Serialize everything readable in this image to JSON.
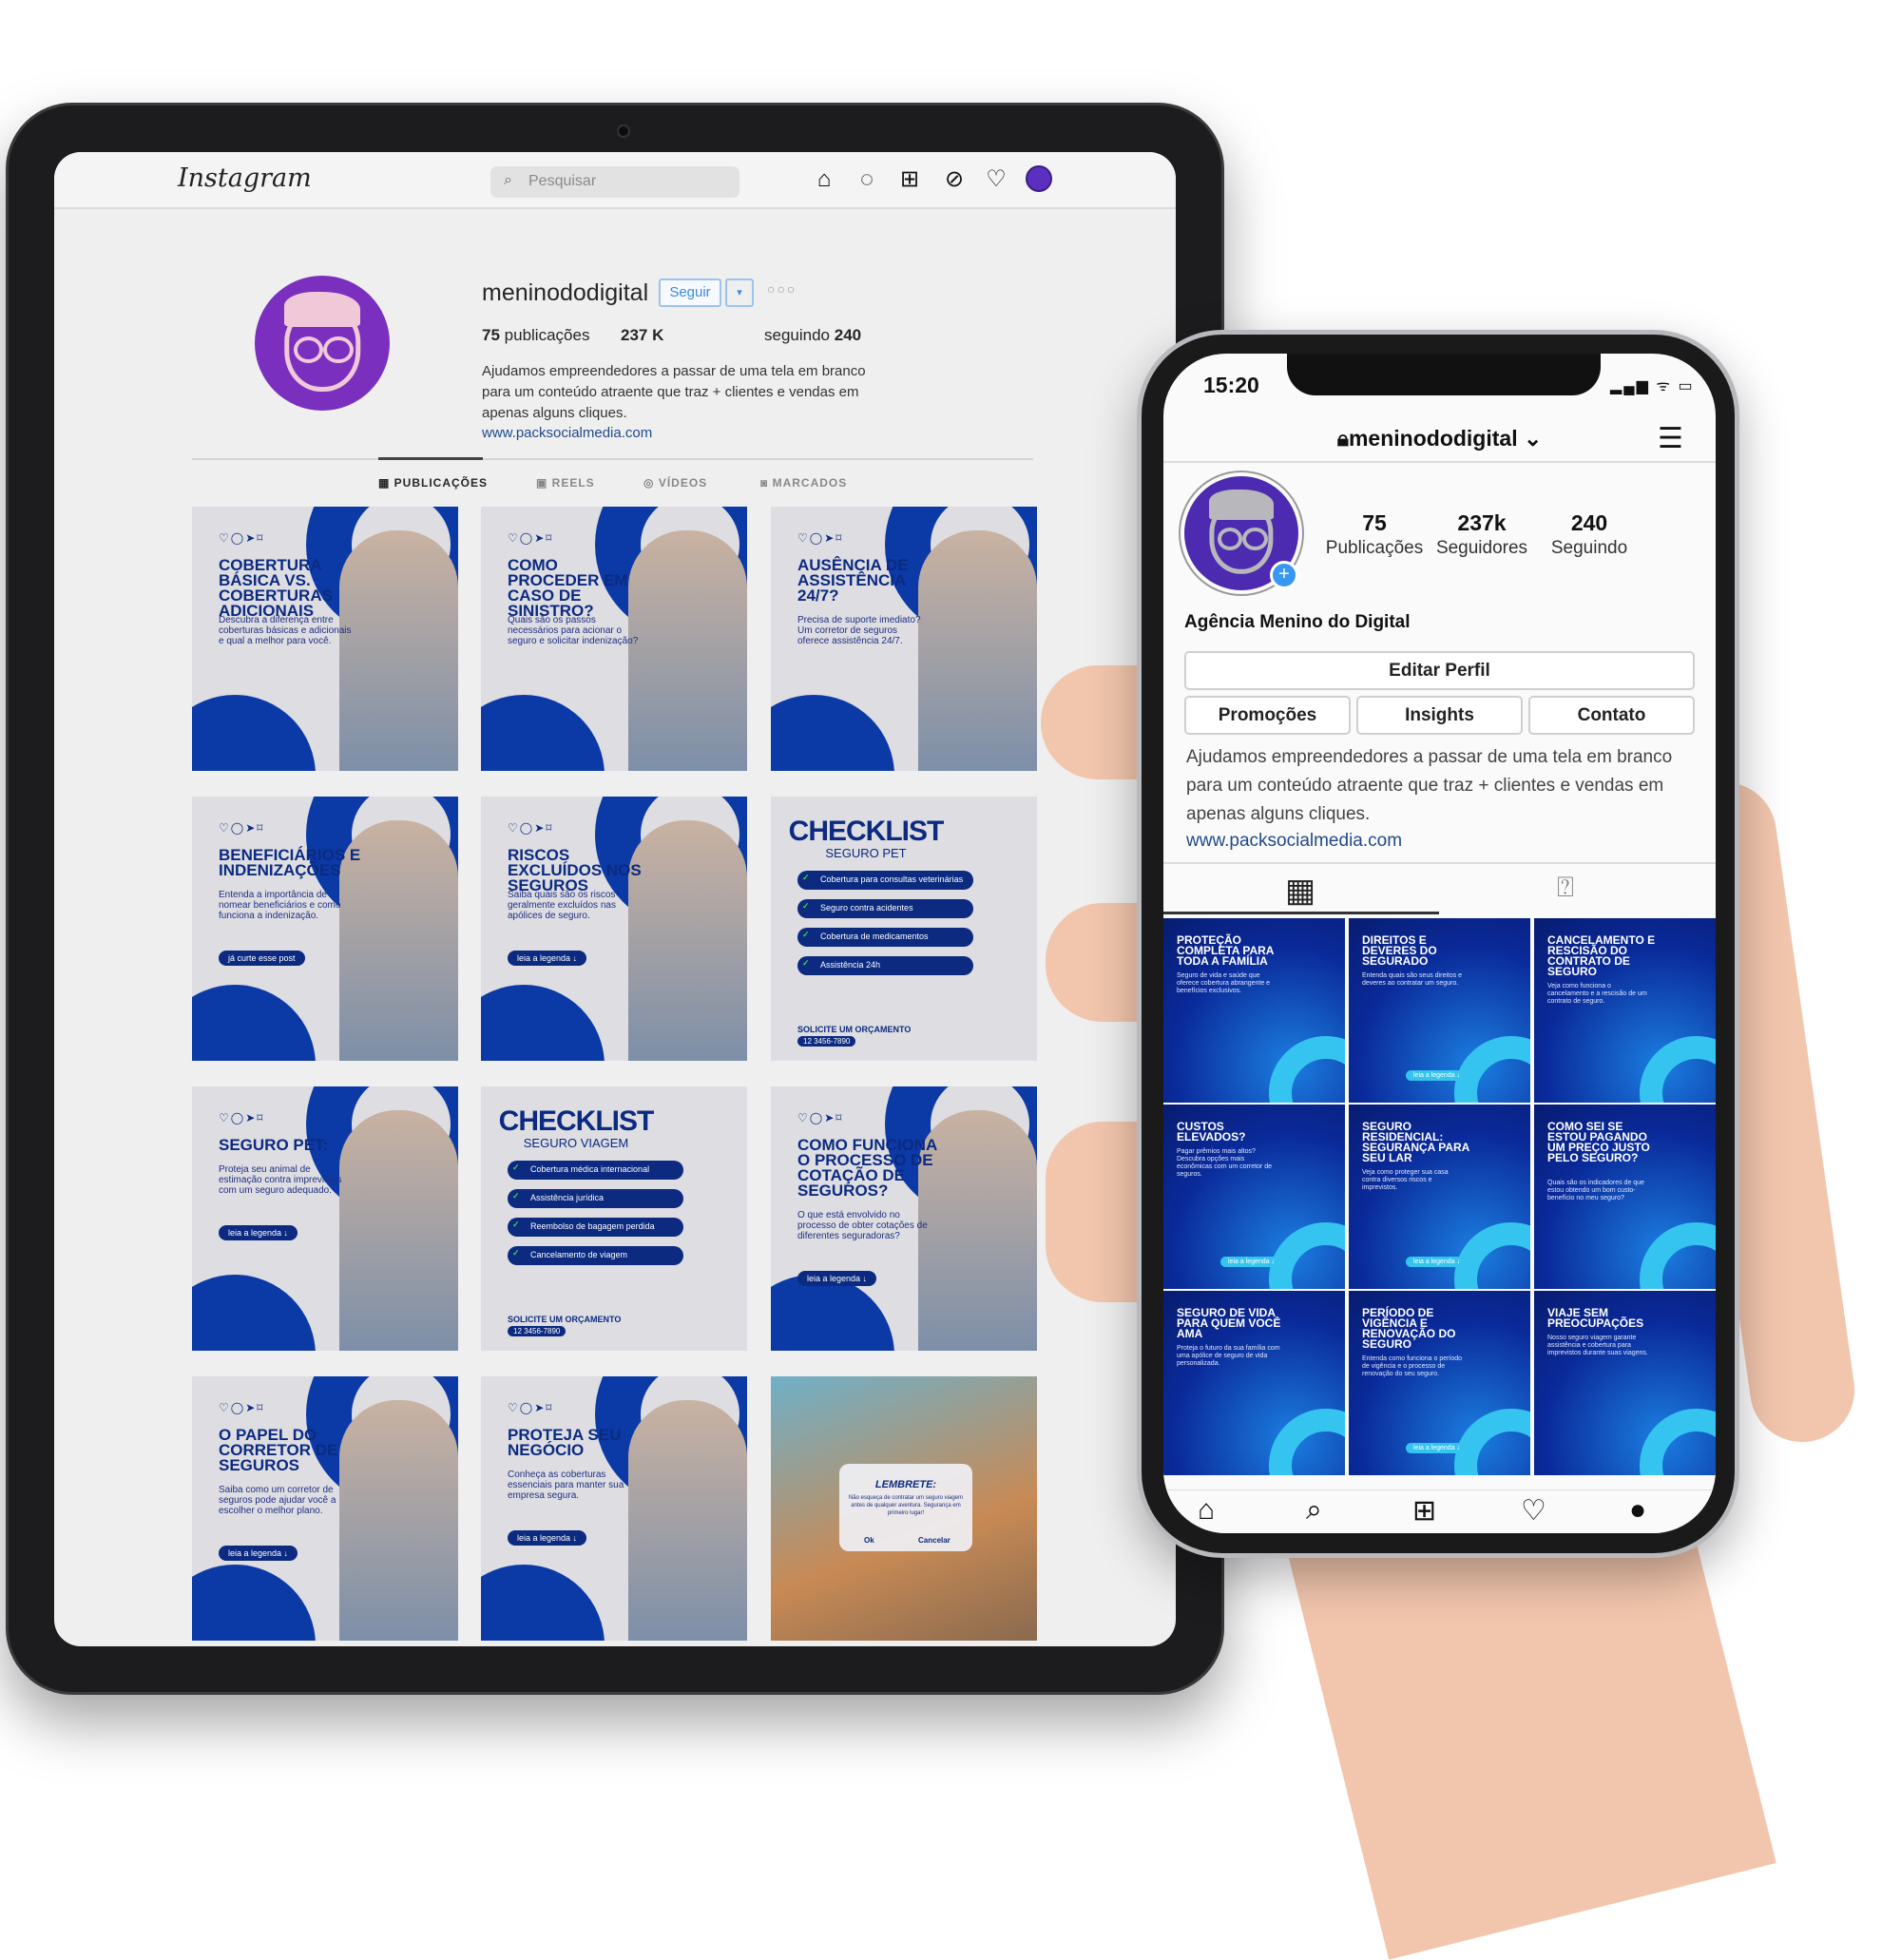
{
  "tablet": {
    "header": {
      "logo": "Instagram",
      "search_placeholder": "Pesquisar",
      "nav_icons": [
        "home-icon",
        "messenger-icon",
        "new-post-icon",
        "explore-icon",
        "heart-icon",
        "avatar-icon"
      ]
    },
    "profile": {
      "username": "meninododigital",
      "follow_label": "Seguir",
      "dropdown_label": "▾",
      "more_label": "○○○",
      "posts_count": "75",
      "posts_label": "publicações",
      "followers": "237 K",
      "following_label": "seguindo",
      "following_count": "240",
      "bio": "Ajudamos empreendedores a passar de uma tela em branco para um conteúdo atraente que traz + clientes e vendas em apenas alguns cliques.",
      "link": "www.packsocialmedia.com"
    },
    "tabs": [
      {
        "label": "PUBLICAÇÕES",
        "icon": "grid-icon",
        "active": true
      },
      {
        "label": "REELS",
        "icon": "reels-icon"
      },
      {
        "label": "VÍDEOS",
        "icon": "play-icon"
      },
      {
        "label": "MARCADOS",
        "icon": "tag-icon"
      }
    ],
    "posts": [
      {
        "type": "std",
        "title": "Cobertura básica vs. coberturas adicionais",
        "body": "Descubra a diferença entre coberturas básicas e adicionais e qual a melhor para você."
      },
      {
        "type": "std",
        "title": "Como proceder em caso de sinistro?",
        "body": "Quais são os passos necessários para acionar o seguro e solicitar indenização?"
      },
      {
        "type": "std",
        "title": "Ausência de assistência 24/7?",
        "body": "Precisa de suporte imediato? Um corretor de seguros oferece assistência 24/7."
      },
      {
        "type": "std",
        "title": "Beneficiários e indenizações",
        "body": "Entenda a importância de nomear beneficiários e como funciona a indenização.",
        "button": "já curte esse post"
      },
      {
        "type": "std",
        "title": "Riscos excluídos nos seguros",
        "body": "Saiba quais são os riscos geralmente excluídos nas apólices de seguro.",
        "button": "leia a legenda ↓"
      },
      {
        "type": "checklist",
        "title": "CHECKLIST",
        "subtitle": "SEGURO PET",
        "items": [
          "Cobertura para consultas veterinárias",
          "Seguro contra acidentes",
          "Cobertura de medicamentos",
          "Assistência 24h"
        ],
        "cta": "SOLICITE UM ORÇAMENTO",
        "phone": "12 3456-7890"
      },
      {
        "type": "std",
        "title": "Seguro pet:",
        "body": "Proteja seu animal de estimação contra imprevistos com um seguro adequado.",
        "button": "leia a legenda ↓"
      },
      {
        "type": "checklist",
        "title": "CHECKLIST",
        "subtitle": "SEGURO VIAGEM",
        "items": [
          "Cobertura médica internacional",
          "Assistência jurídica",
          "Reembolso de bagagem perdida",
          "Cancelamento de viagem"
        ],
        "cta": "SOLICITE UM ORÇAMENTO",
        "phone": "12 3456-7890"
      },
      {
        "type": "std",
        "title": "Como funciona o processo de cotação de seguros?",
        "body": "O que está envolvido no processo de obter cotações de diferentes seguradoras?",
        "button": "leia a legenda ↓"
      },
      {
        "type": "std",
        "title": "O papel do corretor de seguros",
        "body": "Saiba como um corretor de seguros pode ajudar você a escolher o melhor plano.",
        "button": "leia a legenda ↓"
      },
      {
        "type": "std",
        "title": "Proteja seu negócio",
        "body": "Conheça as coberturas essenciais para manter sua empresa segura.",
        "button": "leia a legenda ↓"
      },
      {
        "type": "reminder",
        "title": "LEMBRETE:",
        "body": "Não esqueça de contratar um seguro viagem antes de qualquer aventura. Segurança em primeiro lugar!",
        "ok": "Ok",
        "cancel": "Cancelar"
      }
    ]
  },
  "phone": {
    "time": "15:20",
    "status": "▂▄▆ ᯤ ▭",
    "username": "meninododigital",
    "menu_icon": "hamburger-icon",
    "stats": [
      {
        "value": "75",
        "label": "Publicações"
      },
      {
        "value": "237k",
        "label": "Seguidores"
      },
      {
        "value": "240",
        "label": "Seguindo"
      }
    ],
    "name": "Agência Menino do Digital",
    "edit_label": "Editar Perfil",
    "buttons": [
      "Promoções",
      "Insights",
      "Contato"
    ],
    "bio": "Ajudamos empreendedores a passar de uma tela em branco para um conteúdo atraente que traz + clientes e vendas em apenas alguns cliques.",
    "link": "www.packsocialmedia.com",
    "posts": [
      {
        "title": "Proteção completa para toda a família",
        "body": "Seguro de vida e saúde que oferece cobertura abrangente e benefícios exclusivos."
      },
      {
        "title": "Direitos e deveres do segurado",
        "body": "Entenda quais são seus direitos e deveres ao contratar um seguro.",
        "button": "leia a legenda ↓"
      },
      {
        "title": "Cancelamento e rescisão do contrato de seguro",
        "body": "Veja como funciona o cancelamento e a rescisão de um contrato de seguro."
      },
      {
        "title": "Custos elevados?",
        "body": "Pagar prêmios mais altos? Descubra opções mais econômicas com um corretor de seguros.",
        "button": "leia a legenda ↓"
      },
      {
        "title": "Seguro residencial: segurança para seu lar",
        "body": "Veja como proteger sua casa contra diversos riscos e imprevistos.",
        "button": "leia a legenda ↓"
      },
      {
        "title": "Como sei se estou pagando um preço justo pelo seguro?",
        "body": "Quais são os indicadores de que estou obtendo um bom custo-benefício no meu seguro?"
      },
      {
        "title": "Seguro de vida para quem você ama",
        "body": "Proteja o futuro da sua família com uma apólice de seguro de vida personalizada."
      },
      {
        "title": "Período de vigência e renovação do seguro",
        "body": "Entenda como funciona o período de vigência e o processo de renovação do seu seguro.",
        "button": "leia a legenda ↓"
      },
      {
        "title": "Viaje sem preocupações",
        "body": "Nosso seguro viagem garante assistência e cobertura para imprevistos durante suas viagens."
      }
    ],
    "bottom_nav": [
      "home-icon",
      "search-icon",
      "new-post-icon",
      "heart-icon",
      "profile-icon"
    ]
  },
  "colors": {
    "brand_blue": "#0b3aa6",
    "avatar_purple": "#7b2fbf",
    "link": "#1f4a8a",
    "follow_blue": "#3a8be0"
  }
}
